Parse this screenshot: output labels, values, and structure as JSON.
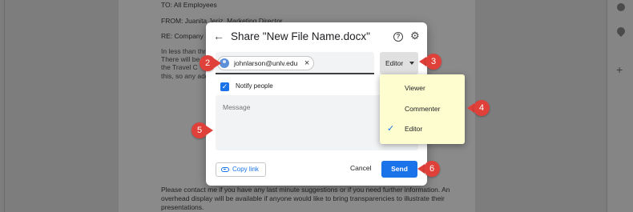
{
  "document": {
    "to_line": "TO: All Employees",
    "from_line": "FROM: Juanita Jeriz, Marketing Director",
    "re_line": "RE: Company M",
    "para1": [
      "In less than thre",
      "There will be",
      "the Travel C",
      "this, so any add"
    ],
    "bottom_para": [
      "Please contact me if you have any last minute suggestions or if you need further information. An",
      "overhead display will be available if anyone would like to bring transparencies to illustrate their",
      "presentations."
    ]
  },
  "dialog": {
    "title": "Share \"New File Name.docx\"",
    "back_icon": "arrow-back-icon",
    "help_icon": "help-circle-icon",
    "settings_icon": "gear-icon",
    "recipient_email": "johnlarson@unlv.edu",
    "role_label": "Editor",
    "notify_label": "Notify people",
    "notify_checked": true,
    "message_placeholder": "Message",
    "copy_link_label": "Copy link",
    "cancel_label": "Cancel",
    "send_label": "Send",
    "accent_color": "#1a73e8"
  },
  "role_menu": {
    "items": [
      "Viewer",
      "Commenter",
      "Editor"
    ],
    "selected": "Editor",
    "highlight_color": "#fefdd0"
  },
  "callouts": [
    "2",
    "3",
    "4",
    "5",
    "6"
  ],
  "callout_color": "#e0403a"
}
